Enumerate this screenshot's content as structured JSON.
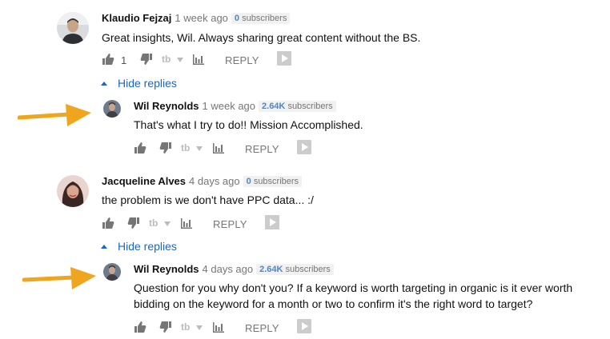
{
  "colors": {
    "link": "#1a66c6",
    "subscriber_count": "#4a88c7",
    "arrow": "#f0a51e",
    "icon": "#767676"
  },
  "comments": [
    {
      "author": "Klaudio Fejzaj",
      "time": "1 week ago",
      "subscriber_count": "0",
      "subscriber_label": "subscribers",
      "text": "Great insights,  Wil. Always sharing great content without the BS.",
      "like_count": "1",
      "reply_label": "REPLY",
      "hide_replies_label": "Hide replies",
      "replies": [
        {
          "author": "Wil Reynolds",
          "time": "1 week ago",
          "subscriber_count": "2.64K",
          "subscriber_label": "subscribers",
          "text": "That's what I try to do!! Mission Accomplished.",
          "reply_label": "REPLY"
        }
      ]
    },
    {
      "author": "Jacqueline Alves",
      "time": "4 days ago",
      "subscriber_count": "0",
      "subscriber_label": "subscribers",
      "text": "the problem is we don't have PPC data... :/",
      "reply_label": "REPLY",
      "hide_replies_label": "Hide replies",
      "replies": [
        {
          "author": "Wil Reynolds",
          "time": "4 days ago",
          "subscriber_count": "2.64K",
          "subscriber_label": "subscribers",
          "text_lines": [
            "Question for you why don't you? If a keyword is worth targeting in organic is it ever worth",
            "bidding on the keyword for a month or two to confirm it's the right word to target?"
          ],
          "reply_label": "REPLY"
        }
      ]
    }
  ],
  "icons": {
    "like": "thumbs-up-icon",
    "dislike": "thumbs-down-icon",
    "translate": "tb-dropdown-icon",
    "analytics": "bar-chart-icon",
    "promote": "play-badge-icon",
    "annotation": "orange-arrow"
  }
}
